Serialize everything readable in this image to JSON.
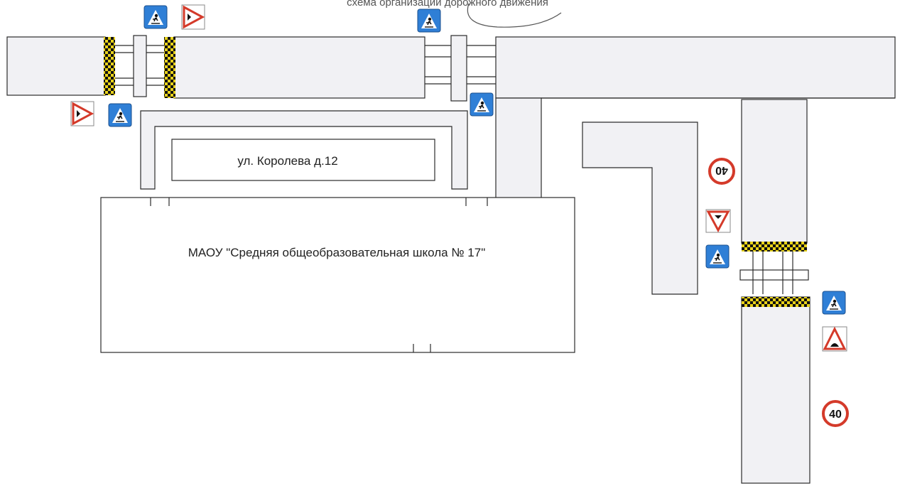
{
  "caption": "схема организации дорожного движения",
  "labels": {
    "residential_building": "ул. Королева д.12",
    "school": "МАОУ \"Средняя общеобразовательная школа № 17\""
  },
  "speed_limit": "40",
  "colors": {
    "outline": "#2b2b2b",
    "road_fill": "#f1f1f4",
    "sign_blue": "#2f7fd6",
    "sign_red": "#d43a2a",
    "bump_yellow": "#e8d21a",
    "bump_black": "#111111"
  },
  "signs": [
    {
      "type": "pedestrian-crossing-sign",
      "icon": "pedestrian-crossing-icon"
    },
    {
      "type": "artificial-bump-sign",
      "icon": "bump-icon"
    },
    {
      "type": "speed-limit-sign",
      "icon": "speed-limit-icon"
    },
    {
      "type": "give-way-sign",
      "icon": "give-way-icon"
    }
  ]
}
